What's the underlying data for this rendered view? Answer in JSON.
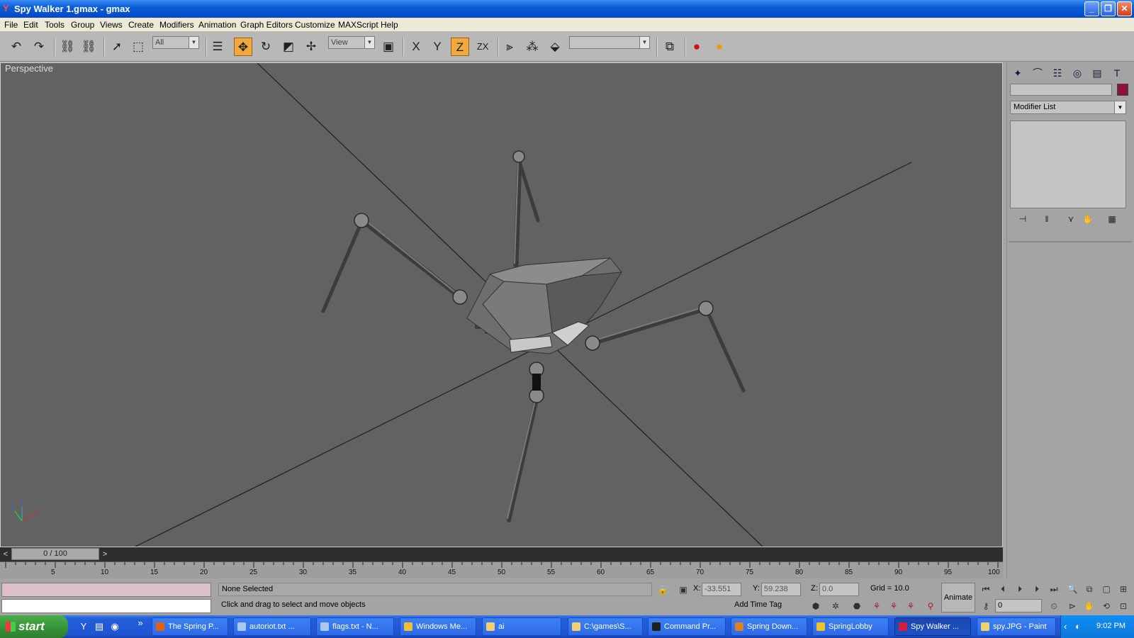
{
  "window": {
    "title": "Spy Walker 1.gmax - gmax",
    "minimize": "_",
    "maximize": "❐",
    "close": "✕"
  },
  "menu": [
    "File",
    "Edit",
    "Tools",
    "Group",
    "Views",
    "Create",
    "Modifiers",
    "Animation",
    "Graph Editors",
    "Customize",
    "MAXScript",
    "Help"
  ],
  "toolbar": {
    "selection_filter": "All",
    "reference_coord": "View",
    "named_selection": "",
    "axis_labels": [
      "X",
      "Y",
      "Z",
      "ZX"
    ],
    "active_tool": "select-and-move"
  },
  "viewport": {
    "label": "Perspective",
    "axis_tripod": [
      "y",
      "z",
      "x"
    ],
    "background": "#626262"
  },
  "command_panel": {
    "object_name": "",
    "object_color": "#8c1236",
    "modifier_list": "Modifier List"
  },
  "time_slider": {
    "frame_display": "0 / 100",
    "prev": "<",
    "next": ">"
  },
  "ruler_ticks": [
    "5",
    "10",
    "15",
    "20",
    "25",
    "30",
    "35",
    "40",
    "45",
    "50",
    "55",
    "60",
    "65",
    "70",
    "75",
    "80",
    "85",
    "90",
    "95",
    "100"
  ],
  "status": {
    "selection": "None Selected",
    "prompt": "Click and drag to select and move objects",
    "x_label": "X:",
    "x_value": "-33.551",
    "y_label": "Y:",
    "y_value": "59.238",
    "z_label": "Z:",
    "z_value": "0.0",
    "grid": "Grid = 10.0",
    "add_time_tag": "Add Time Tag",
    "animate": "Animate",
    "current_frame": "0"
  },
  "taskbar": {
    "start": "start",
    "overflow": "»",
    "tasks": [
      {
        "label": "The Spring P...",
        "icon_color": "#e06010"
      },
      {
        "label": "autoriot.txt ...",
        "icon_color": "#a8c8f0"
      },
      {
        "label": "flags.txt - N...",
        "icon_color": "#a8c8f0"
      },
      {
        "label": "Windows Me...",
        "icon_color": "#f0c030"
      },
      {
        "label": "ai",
        "icon_color": "#f0d070"
      },
      {
        "label": "C:\\games\\S...",
        "icon_color": "#f0d070"
      },
      {
        "label": "Command Pr...",
        "icon_color": "#202020"
      },
      {
        "label": "Spring Down...",
        "icon_color": "#e08020"
      },
      {
        "label": "SpringLobby",
        "icon_color": "#f0c030"
      },
      {
        "label": "Spy Walker ...",
        "icon_color": "#d02040"
      },
      {
        "label": "spy.JPG - Paint",
        "icon_color": "#f0d070"
      }
    ],
    "clock": "9:02 PM"
  }
}
